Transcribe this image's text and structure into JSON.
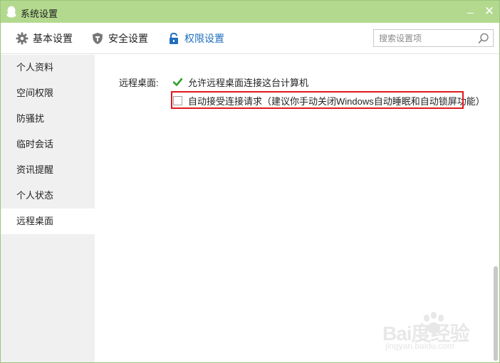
{
  "window": {
    "title": "系统设置"
  },
  "toolbar": {
    "tabs": [
      {
        "label": "基本设置",
        "icon": "gear-icon"
      },
      {
        "label": "安全设置",
        "icon": "shield-icon"
      },
      {
        "label": "权限设置",
        "icon": "lock-icon",
        "active": true
      }
    ],
    "search_placeholder": "搜索设置项"
  },
  "sidebar": {
    "items": [
      {
        "label": "个人资料"
      },
      {
        "label": "空间权限"
      },
      {
        "label": "防骚扰"
      },
      {
        "label": "临时会话"
      },
      {
        "label": "资讯提醒"
      },
      {
        "label": "个人状态"
      },
      {
        "label": "远程桌面",
        "active": true
      }
    ]
  },
  "main": {
    "section_label": "远程桌面:",
    "options": [
      {
        "label": "允许远程桌面连接这台计算机",
        "checked": true
      },
      {
        "label": "自动接受连接请求（建议你手动关闭Windows自动睡眠和自动锁屏功能）",
        "checked": false
      }
    ]
  },
  "watermark": {
    "main": "Bai度经验",
    "sub": "jingyan.baidu.com"
  },
  "colors": {
    "titlebar": "#b3d98f",
    "accent": "#1f6fbf",
    "check": "#2aa12a",
    "highlight": "#e0191f"
  }
}
